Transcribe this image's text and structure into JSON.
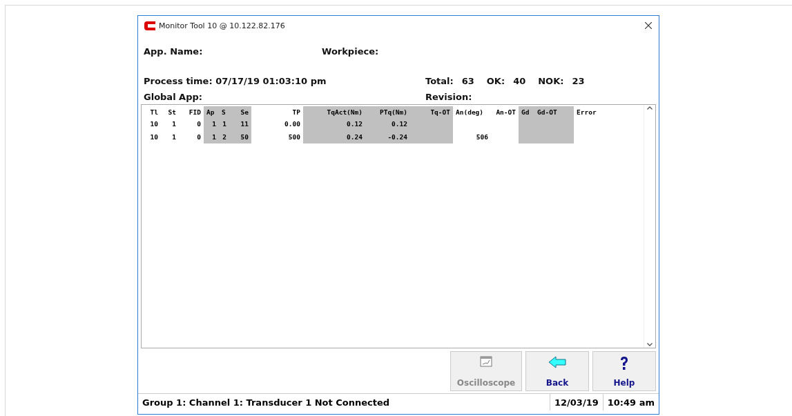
{
  "window": {
    "title": "Monitor Tool 10 @ 10.122.82.176"
  },
  "info": {
    "app_name": "App. Name:",
    "workpiece": "Workpiece:",
    "process_time": "Process time: 07/17/19  01:03:10 pm",
    "global_app": "Global App:",
    "revision": "Revision:",
    "counts": [
      {
        "label": "Total:",
        "value": "63"
      },
      {
        "label": "OK:",
        "value": "40"
      },
      {
        "label": "NOK:",
        "value": "23"
      }
    ]
  },
  "table": {
    "columns": [
      {
        "label": "Tl",
        "shaded": false
      },
      {
        "label": "St",
        "shaded": false
      },
      {
        "label": "FID",
        "shaded": false
      },
      {
        "label": "Ap",
        "shaded": true
      },
      {
        "label": "S",
        "shaded": true
      },
      {
        "label": "Se",
        "shaded": true
      },
      {
        "label": "TP",
        "shaded": false
      },
      {
        "label": "TqAct(Nm)",
        "shaded": true
      },
      {
        "label": "PTq(Nm)",
        "shaded": true
      },
      {
        "label": "Tq-OT",
        "shaded": true
      },
      {
        "label": "An(deg)",
        "shaded": false
      },
      {
        "label": "An-OT",
        "shaded": false
      },
      {
        "label": "Gd",
        "shaded": true
      },
      {
        "label": "Gd-OT",
        "shaded": true
      },
      {
        "label": "Error",
        "shaded": false
      }
    ],
    "rows": [
      [
        "10",
        "1",
        "0",
        "1",
        "1",
        "11",
        "0.00",
        "0.12",
        "0.12",
        null,
        null,
        null,
        null,
        null,
        null
      ],
      [
        "10",
        "1",
        "0",
        "1",
        "2",
        "50",
        "500",
        "0.24",
        "-0.24",
        null,
        "506",
        null,
        null,
        null,
        null
      ]
    ]
  },
  "buttons": [
    {
      "kind": "oscilloscope",
      "label": "Oscilloscope",
      "disabled": true
    },
    {
      "kind": "back",
      "label": "Back",
      "disabled": false
    },
    {
      "kind": "help",
      "label": "Help",
      "disabled": false
    }
  ],
  "status_bar": {
    "message": "Group 1: Channel 1: Transducer 1 Not Connected",
    "date": "12/03/19",
    "time": "10:49 am"
  }
}
